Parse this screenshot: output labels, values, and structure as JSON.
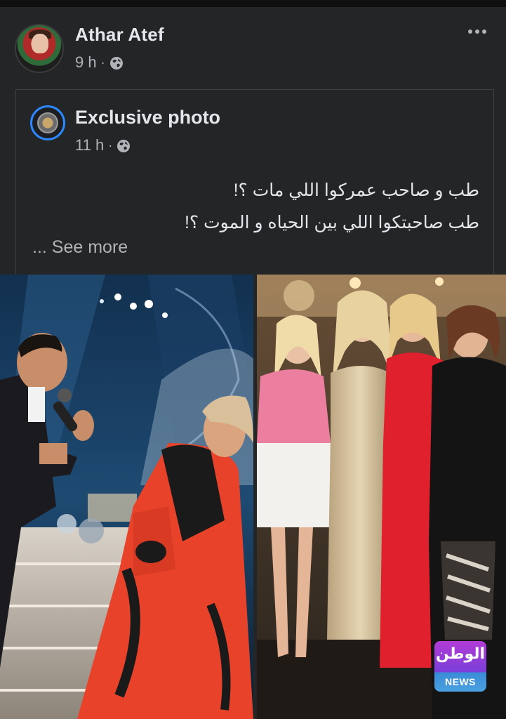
{
  "post": {
    "author": "Athar Atef",
    "time": "9 h",
    "separator": "·",
    "privacy_icon": "globe-icon",
    "menu_icon": "more-horizontal-icon"
  },
  "shared": {
    "page_name": "Exclusive photo",
    "time": "11 h",
    "separator": "·",
    "privacy_icon": "globe-icon",
    "text_lines": [
      "طب و صاحب عمركوا اللي مات ؟!",
      "طب صاحبتكوا اللي بين الحياه و الموت ؟!"
    ],
    "see_more": "... See more"
  },
  "watermark": {
    "brand": "الوطن",
    "label": "NEWS"
  },
  "colors": {
    "background": "#242526",
    "text_primary": "#e4e6eb",
    "text_secondary": "#b0b3b8",
    "accent_blue": "#2d88ff"
  }
}
